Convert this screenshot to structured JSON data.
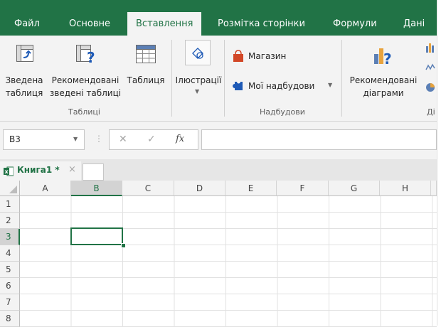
{
  "tabs": [
    {
      "label": "Файл"
    },
    {
      "label": "Основне"
    },
    {
      "label": "Вставлення"
    },
    {
      "label": "Розмітка сторінки"
    },
    {
      "label": "Формули"
    },
    {
      "label": "Дані"
    }
  ],
  "ribbon": {
    "pivot_table": {
      "line1": "Зведена",
      "line2": "таблиця"
    },
    "recommended_pivots": {
      "line1": "Рекомендовані",
      "line2": "зведені таблиці"
    },
    "table": {
      "label": "Таблиця"
    },
    "illustrations": {
      "label": "Ілюстрації"
    },
    "store": {
      "label": "Магазин"
    },
    "my_addins": {
      "label": "Мої надбудови"
    },
    "recommended_charts": {
      "line1": "Рекомендовані",
      "line2": "діаграми"
    },
    "truncated_group": "Ді",
    "groups": {
      "tables": "Таблиці",
      "addins": "Надбудови"
    }
  },
  "formula_bar": {
    "name_box": "B3",
    "fx": "fx",
    "cancel": "✕",
    "enter": "✓",
    "value": ""
  },
  "workbook": {
    "tab_label": "Книга1 *",
    "close": "×"
  },
  "grid": {
    "columns": [
      "A",
      "B",
      "C",
      "D",
      "E",
      "F",
      "G",
      "H"
    ],
    "rows": [
      "1",
      "2",
      "3",
      "4",
      "5",
      "6",
      "7",
      "8"
    ],
    "active_cell": "B3"
  },
  "colors": {
    "brand": "#217346",
    "ribbon_bg": "#f3f3f3",
    "store_icon": "#d24726",
    "addins_icon": "#1e5ab6",
    "chart_bars": "#e8a33d"
  }
}
